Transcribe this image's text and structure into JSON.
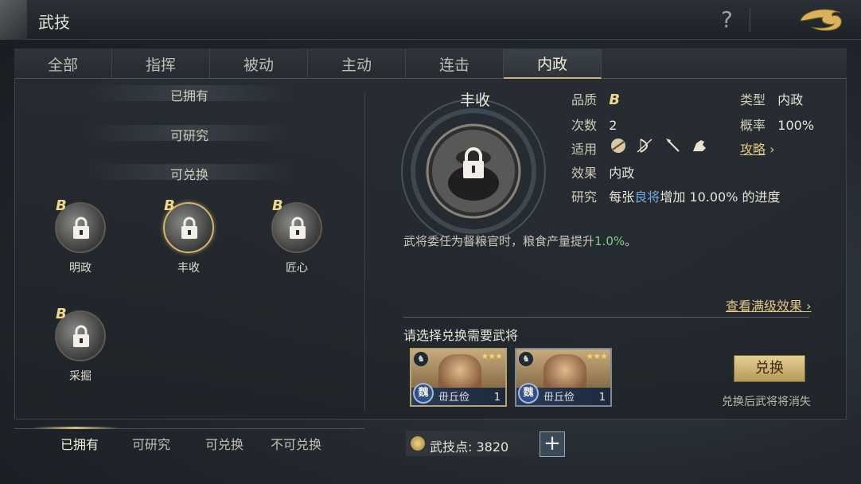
{
  "header": {
    "title": "武技",
    "help_label": "?"
  },
  "tabs": [
    {
      "label": "全部"
    },
    {
      "label": "指挥"
    },
    {
      "label": "被动"
    },
    {
      "label": "主动"
    },
    {
      "label": "连击"
    },
    {
      "label": "内政",
      "active": true
    }
  ],
  "left": {
    "sections": [
      "已拥有",
      "可研究",
      "可兑换"
    ],
    "skills": [
      {
        "grade": "B",
        "name": "明政"
      },
      {
        "grade": "B",
        "name": "丰收",
        "selected": true
      },
      {
        "grade": "B",
        "name": "匠心"
      },
      {
        "grade": "B",
        "name": "采掘"
      }
    ]
  },
  "detail": {
    "name": "丰收",
    "quality_label": "品质",
    "quality": "B",
    "type_label": "类型",
    "type": "内政",
    "count_label": "次数",
    "count": "2",
    "rate_label": "概率",
    "rate": "100%",
    "applicable_label": "适用",
    "applicable_icons": [
      "shield-icon",
      "bow-icon",
      "spear-icon",
      "horse-icon"
    ],
    "strategy_label": "攻略",
    "effect_label": "效果",
    "effect": "内政",
    "research_label": "研究",
    "research_pre": "每张",
    "research_highlight": "良将",
    "research_post": "增加 10.00% 的进度",
    "description_pre": "武将委任为督粮官时，粮食产量提升",
    "description_value": "1.0%",
    "description_post": "。",
    "full_effect_link": "查看满级效果",
    "choose_label": "请选择兑换需要武将",
    "cards": [
      {
        "faction": "魏",
        "name": "毌丘俭",
        "level": "1",
        "stars": "★★★"
      },
      {
        "faction": "魏",
        "name": "毌丘俭",
        "level": "1",
        "stars": "★★★"
      }
    ],
    "exchange_button": "兑换",
    "exchange_note": "兑换后武将将消失"
  },
  "bottom_tabs": [
    "已拥有",
    "可研究",
    "可兑换",
    "不可兑换"
  ],
  "points": {
    "label": "武技点:",
    "value": "3820",
    "plus": "+"
  },
  "colors": {
    "accent_gold": "#d4b56a",
    "highlight_blue": "#6fa7e0",
    "highlight_green": "#7ed37e"
  }
}
